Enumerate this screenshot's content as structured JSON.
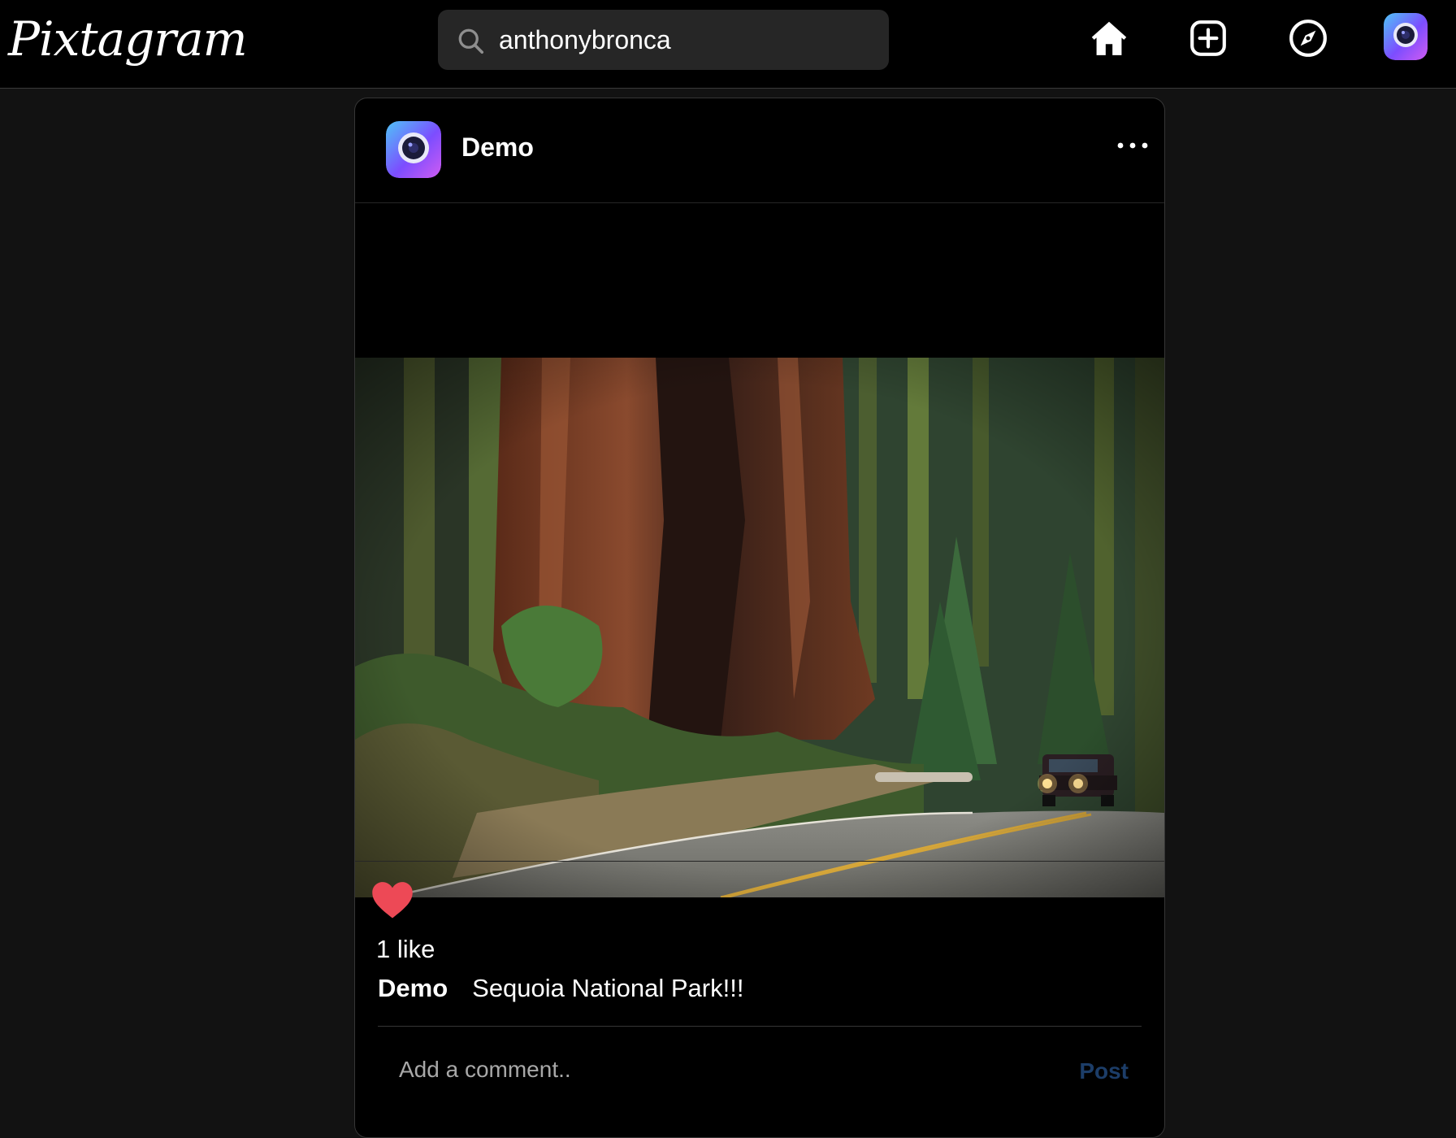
{
  "header": {
    "logo": "Pixtagram",
    "search": {
      "value": "anthonybronca",
      "placeholder": "Search"
    },
    "icons": [
      "home-icon",
      "new-post-icon",
      "explore-compass-icon",
      "profile-avatar"
    ]
  },
  "post": {
    "username": "Demo",
    "likes_text": "1 like",
    "liked": true,
    "caption_user": "Demo",
    "caption_text": "Sequoia National Park!!!",
    "comment_placeholder": "Add a comment..",
    "post_label": "Post"
  },
  "colors": {
    "background": "#121212",
    "card": "#000000",
    "heart": "#ed4956",
    "post_button_disabled": "#1c3d68",
    "avatar_gradient": [
      "#4fc3f7",
      "#7c4dff",
      "#d05cf2"
    ]
  }
}
